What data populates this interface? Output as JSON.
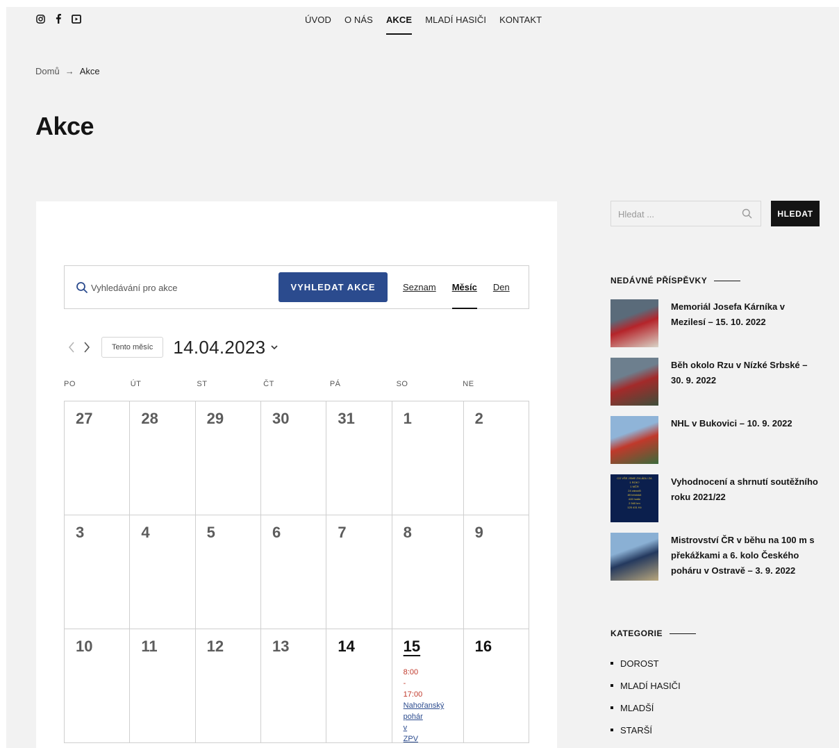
{
  "header": {
    "social": [
      {
        "icon": "instagram-icon"
      },
      {
        "icon": "facebook-icon"
      },
      {
        "icon": "youtube-icon"
      }
    ],
    "nav": [
      {
        "label": "ÚVOD",
        "active": false
      },
      {
        "label": "O NÁS",
        "active": false
      },
      {
        "label": "AKCE",
        "active": true
      },
      {
        "label": "MLADÍ HASIČI",
        "active": false
      },
      {
        "label": "KONTAKT",
        "active": false
      }
    ]
  },
  "breadcrumb": {
    "home": "Domů",
    "separator": "→",
    "current": "Akce"
  },
  "page_title": "Akce",
  "events_bar": {
    "search_placeholder": "Vyhledávání pro akce",
    "find_button": "VYHLEDAT AKCE",
    "views": [
      {
        "label": "Seznam",
        "active": false
      },
      {
        "label": "Měsíc",
        "active": true
      },
      {
        "label": "Den",
        "active": false
      }
    ]
  },
  "toolbar": {
    "prev_icon": "chevron-left-icon",
    "next_icon": "chevron-right-icon",
    "today_button": "Tento měsíc",
    "date": "14.04.2023",
    "date_dropdown_icon": "chevron-down-icon"
  },
  "calendar": {
    "weekdays": [
      "PO",
      "ÚT",
      "ST",
      "ČT",
      "PÁ",
      "SO",
      "NE"
    ],
    "weeks": [
      [
        {
          "day": "27",
          "current": false
        },
        {
          "day": "28",
          "current": false
        },
        {
          "day": "29",
          "current": false
        },
        {
          "day": "30",
          "current": false
        },
        {
          "day": "31",
          "current": false
        },
        {
          "day": "1",
          "current": false
        },
        {
          "day": "2",
          "current": false
        }
      ],
      [
        {
          "day": "3",
          "current": false
        },
        {
          "day": "4",
          "current": false
        },
        {
          "day": "5",
          "current": false
        },
        {
          "day": "6",
          "current": false
        },
        {
          "day": "7",
          "current": false
        },
        {
          "day": "8",
          "current": false
        },
        {
          "day": "9",
          "current": false
        }
      ],
      [
        {
          "day": "10",
          "current": false
        },
        {
          "day": "11",
          "current": false
        },
        {
          "day": "12",
          "current": false
        },
        {
          "day": "13",
          "current": false
        },
        {
          "day": "14",
          "current": true
        },
        {
          "day": "15",
          "current": true,
          "today": true,
          "event": {
            "start": "8:00",
            "dash": "-",
            "end": "17:00",
            "title_lines": [
              "Nahořanský",
              "pohár",
              "v",
              "ZPV"
            ]
          }
        },
        {
          "day": "16",
          "current": true
        }
      ]
    ]
  },
  "sidebar": {
    "search_placeholder": "Hledat ...",
    "search_button": "HLEDAT",
    "recent_title": "NEDÁVNÉ PŘÍSPĚVKY",
    "recent_posts": [
      {
        "title": "Memoriál Josefa Kárníka v Mezilesí – 15. 10. 2022",
        "thumb_colors": [
          "#5a6b7a",
          "#b5242a",
          "#d9d4c8"
        ]
      },
      {
        "title": "Běh okolo Rzu v Nízké Srbské – 30. 9. 2022",
        "thumb_colors": [
          "#6d7f8e",
          "#a32a2a",
          "#3e4f3b"
        ]
      },
      {
        "title": "NHL v Bukovici – 10. 9. 2022",
        "thumb_colors": [
          "#8fb4d8",
          "#c0392b",
          "#3b6a3b"
        ]
      },
      {
        "title": "Vyhodnocení a shrnutí soutěžního roku 2021/22",
        "thumb_colors": [
          "#0b1f4d",
          "#e3c33a",
          "#ffffff"
        ]
      },
      {
        "title": "Mistrovství ČR v běhu na 100 m s překážkami a 6. kolo Českého poháru v Ostravě – 3. 9. 2022",
        "thumb_colors": [
          "#8ab0d4",
          "#24395e",
          "#b9a77c"
        ]
      }
    ],
    "thumb_art": {
      "4": {
        "lines": [
          "CO VŠE JSME ZVLÁDLI ZA",
          "1 ROK?",
          "1  MČR",
          "24  závodů",
          "89  tréninků",
          "415  hodin",
          "2 540  km",
          "120 431  Kč"
        ]
      }
    },
    "categories_title": "KATEGORIE",
    "categories": [
      "DOROST",
      "MLADÍ HASIČI",
      "MLADŠÍ",
      "STARŠÍ"
    ]
  }
}
